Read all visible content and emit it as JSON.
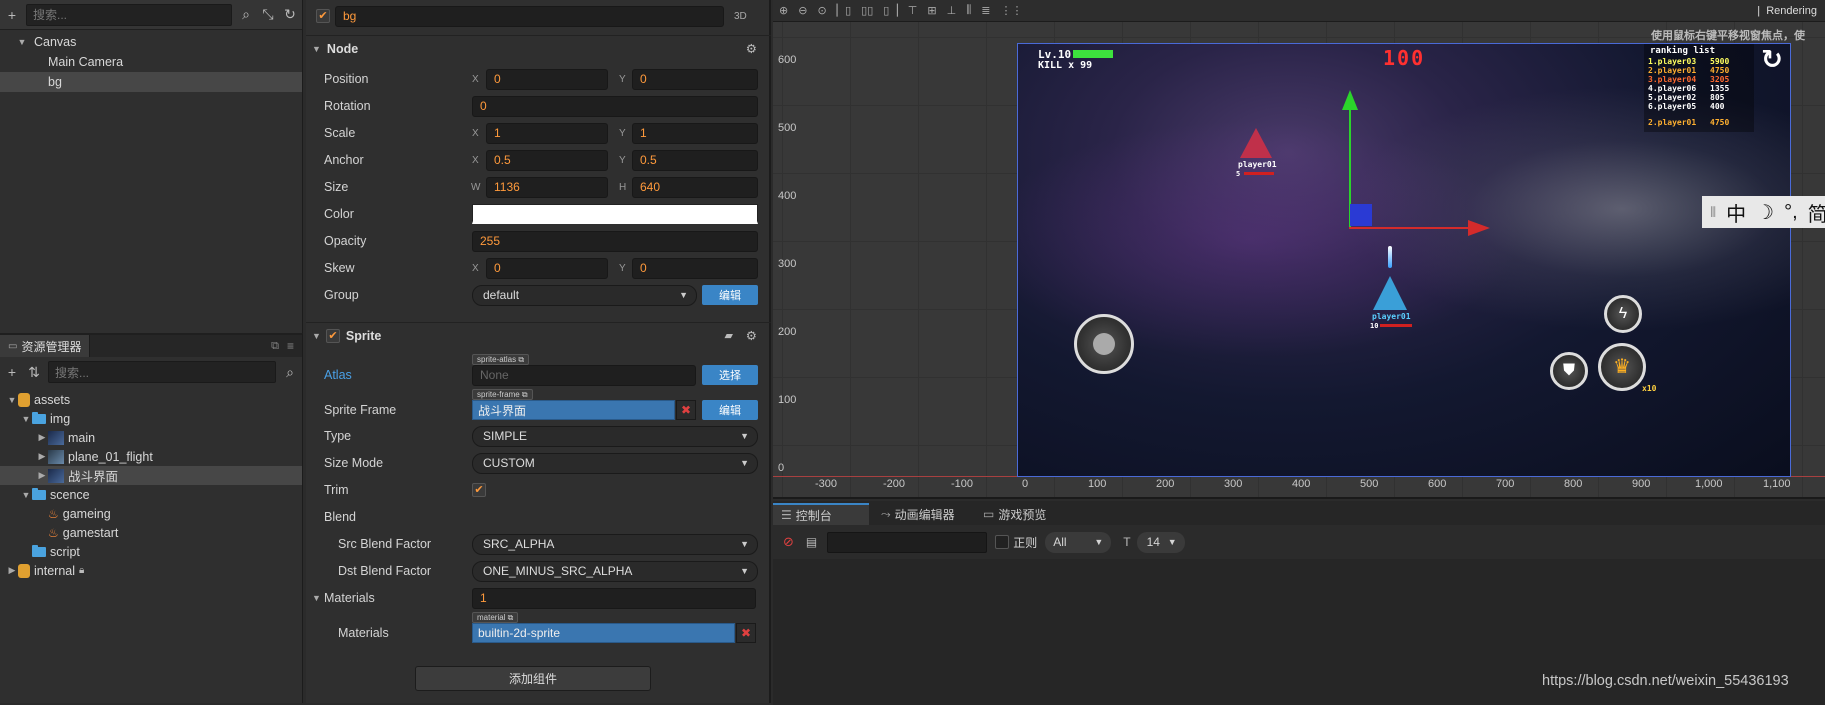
{
  "hierarchy": {
    "search_placeholder": "搜索...",
    "nodes": [
      "Canvas",
      "Main Camera",
      "bg"
    ]
  },
  "assets": {
    "panel_title": "资源管理器",
    "search_placeholder": "搜索...",
    "items": [
      "assets",
      "img",
      "main",
      "plane_01_flight",
      "战斗界面",
      "scence",
      "gameing",
      "gamestart",
      "script",
      "internal"
    ]
  },
  "inspector": {
    "node_name": "bg",
    "mode_3d": "3D",
    "node_section": "Node",
    "position": {
      "label": "Position",
      "x": "0",
      "y": "0"
    },
    "rotation": {
      "label": "Rotation",
      "value": "0"
    },
    "scale": {
      "label": "Scale",
      "x": "1",
      "y": "1"
    },
    "anchor": {
      "label": "Anchor",
      "x": "0.5",
      "y": "0.5"
    },
    "size": {
      "label": "Size",
      "w": "1136",
      "h": "640"
    },
    "color": {
      "label": "Color",
      "value": "#ffffff"
    },
    "opacity": {
      "label": "Opacity",
      "value": "255"
    },
    "skew": {
      "label": "Skew",
      "x": "0",
      "y": "0"
    },
    "group": {
      "label": "Group",
      "value": "default",
      "edit": "编辑"
    },
    "axis_x": "X",
    "axis_y": "Y",
    "axis_w": "W",
    "axis_h": "H",
    "sprite_section": "Sprite",
    "atlas": {
      "label": "Atlas",
      "tag": "sprite-atlas",
      "value": "None",
      "btn": "选择"
    },
    "sprite_frame": {
      "label": "Sprite Frame",
      "tag": "sprite-frame",
      "value": "战斗界面",
      "btn": "编辑"
    },
    "type": {
      "label": "Type",
      "value": "SIMPLE"
    },
    "size_mode": {
      "label": "Size Mode",
      "value": "CUSTOM"
    },
    "trim": {
      "label": "Trim",
      "checked": true
    },
    "blend": {
      "label": "Blend"
    },
    "src_blend": {
      "label": "Src Blend Factor",
      "value": "SRC_ALPHA"
    },
    "dst_blend": {
      "label": "Dst Blend Factor",
      "value": "ONE_MINUS_SRC_ALPHA"
    },
    "materials_count": {
      "label": "Materials",
      "value": "1"
    },
    "materials": {
      "label": "Materials",
      "tag": "material",
      "value": "builtin-2d-sprite"
    },
    "add_component": "添加组件"
  },
  "scene": {
    "rendering": "Rendering",
    "hint": "使用鼠标右键平移视窗焦点，使",
    "y_labels": [
      "600",
      "500",
      "400",
      "300",
      "200",
      "100",
      "0"
    ],
    "x_labels": [
      "-300",
      "-200",
      "-100",
      "0",
      "100",
      "200",
      "300",
      "400",
      "500",
      "600",
      "700",
      "800",
      "900",
      "1,000",
      "1,100"
    ],
    "game": {
      "level": "Lv.10",
      "kill": "KILL x 99",
      "score": "100",
      "ranking_title": "ranking list",
      "ranking": [
        {
          "name": "1.player03",
          "score": "5900",
          "color": "#ffff60"
        },
        {
          "name": "2.player01",
          "score": "4750",
          "color": "#ffb030"
        },
        {
          "name": "3.player04",
          "score": "3205",
          "color": "#ff6a30"
        },
        {
          "name": "4.player06",
          "score": "1355",
          "color": "#ffffff"
        },
        {
          "name": "5.player02",
          "score": "805",
          "color": "#ffffff"
        },
        {
          "name": "6.player05",
          "score": "400",
          "color": "#ffffff"
        }
      ],
      "me": {
        "name": "2.player01",
        "score": "4750"
      },
      "enemy_label": "player01",
      "enemy_hp": "5",
      "player_label": "player01",
      "player_hp": "10",
      "bomb_count": "x10"
    }
  },
  "console": {
    "tabs": [
      "控制台",
      "动画编辑器",
      "游戏预览"
    ],
    "regex": "正则",
    "level": "All",
    "font_size": "14"
  },
  "ime": {
    "chars": [
      "中",
      "☽",
      "°,",
      "简"
    ]
  },
  "watermark": "https://blog.csdn.net/weixin_55436193"
}
